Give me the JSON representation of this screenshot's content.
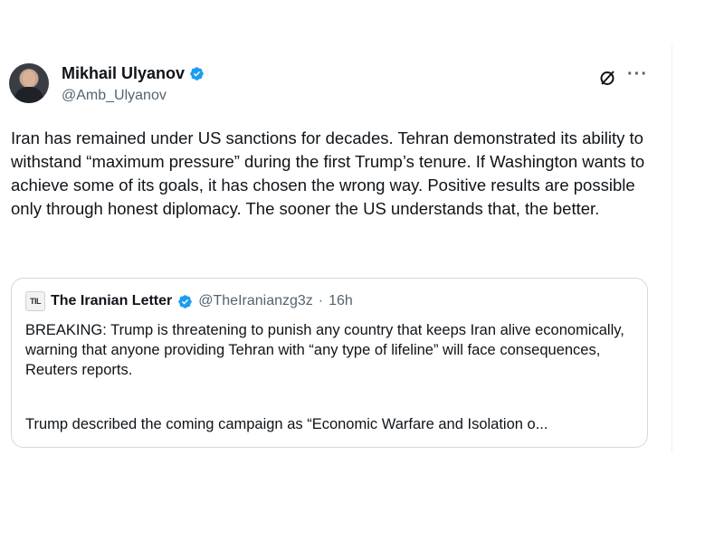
{
  "author": {
    "display_name": "Mikhail Ulyanov",
    "handle": "@Amb_Ulyanov",
    "verified_icon": "verified-badge-icon",
    "avatar": "avatar"
  },
  "actions": {
    "grok_icon": "grok-icon",
    "more_icon": "more-icon",
    "more_label": "···"
  },
  "tweet": {
    "text": "Iran has remained under US sanctions for decades. Tehran demonstrated its ability to withstand “maximum pressure” during the first Trump’s tenure. If Washington wants to achieve some of its goals, it has chosen the wrong way. Positive results are possible only through honest diplomacy. The sooner the US understands that, the better."
  },
  "quote": {
    "logo_text": "TIL",
    "name": "The Iranian Letter",
    "handle": "@TheIranianzg3z",
    "dot": "·",
    "time": "16h",
    "text": "BREAKING: Trump is threatening to punish any country that keeps Iran alive economically, warning that anyone providing Tehran with “any type of lifeline” will face consequences, Reuters reports.",
    "text2": "Trump described the coming campaign as “Economic Warfare and Isolation o..."
  },
  "colors": {
    "text": "#0f1419",
    "secondary": "#536471",
    "verified": "#1d9bf0",
    "border": "#cfd9de"
  }
}
